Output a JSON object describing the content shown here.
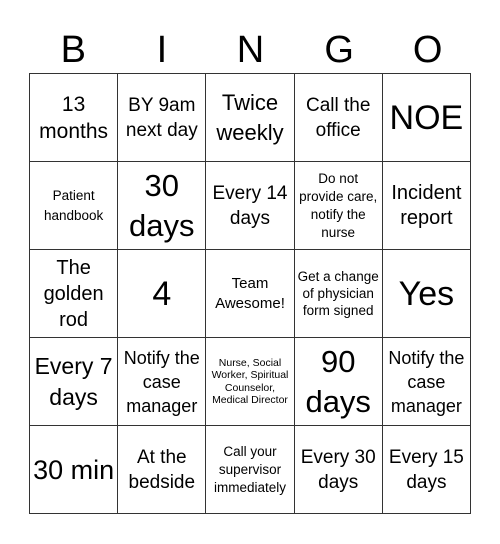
{
  "header": {
    "letters": [
      "B",
      "I",
      "N",
      "G",
      "O"
    ]
  },
  "cells": [
    [
      "13 months",
      "BY 9am next day",
      "Twice weekly",
      "Call the office",
      "NOE"
    ],
    [
      "Patient handbook",
      "30 days",
      "Every 14 days",
      "Do not provide care, notify the nurse",
      "Incident report"
    ],
    [
      "The golden rod",
      "4",
      "Team Awesome!",
      "Get a change of physician form signed",
      "Yes"
    ],
    [
      "Every 7 days",
      "Notify the case manager",
      "Nurse, Social Worker, Spiritual Counselor, Medical Director",
      "90 days",
      "Notify the case manager"
    ],
    [
      "30 min",
      "At the bedside",
      "Call your supervisor immediately",
      "Every 30 days",
      "Every 15 days"
    ]
  ]
}
